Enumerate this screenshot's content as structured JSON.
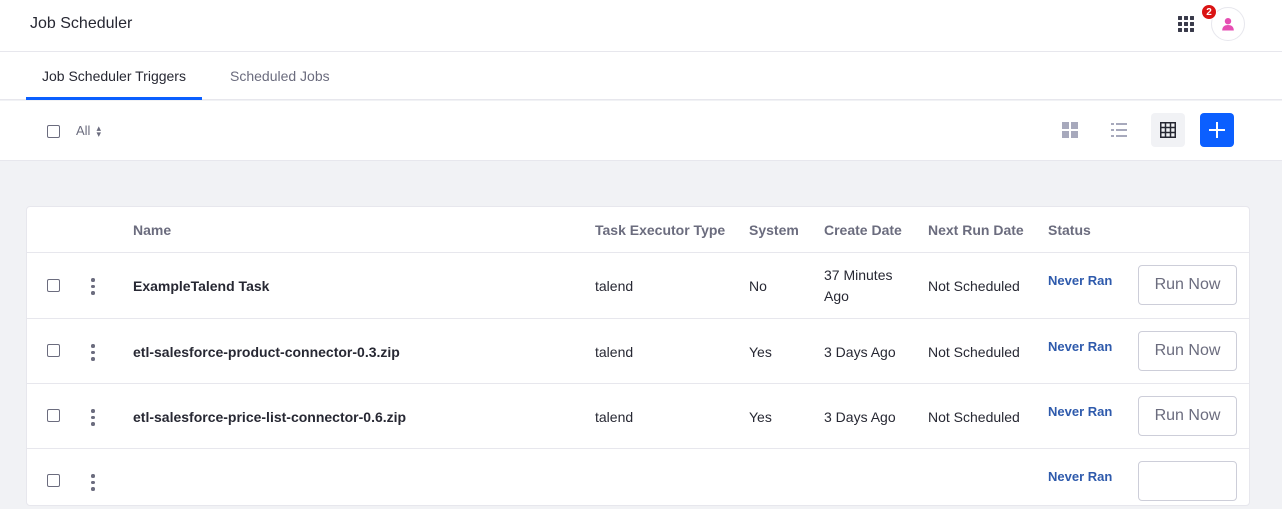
{
  "app": {
    "title": "Job Scheduler",
    "notification_count": "2"
  },
  "tabs": [
    {
      "label": "Job Scheduler Triggers",
      "active": true
    },
    {
      "label": "Scheduled Jobs",
      "active": false
    }
  ],
  "toolbar": {
    "filter_label": "All"
  },
  "table": {
    "headers": [
      "Name",
      "Task Executor Type",
      "System",
      "Create Date",
      "Next Run Date",
      "Status"
    ],
    "rows": [
      {
        "name": "ExampleTalend Task",
        "executor": "talend",
        "system": "No",
        "create_date_line1": "37 Minutes",
        "create_date_line2": "Ago",
        "next_run": "Not Scheduled",
        "status": "Never Ran",
        "action": "Run Now"
      },
      {
        "name": "etl-salesforce-product-connector-0.3.zip",
        "executor": "talend",
        "system": "Yes",
        "create_date_line1": "3 Days Ago",
        "create_date_line2": "",
        "next_run": "Not Scheduled",
        "status": "Never Ran",
        "action": "Run Now"
      },
      {
        "name": "etl-salesforce-price-list-connector-0.6.zip",
        "executor": "talend",
        "system": "Yes",
        "create_date_line1": "3 Days Ago",
        "create_date_line2": "",
        "next_run": "Not Scheduled",
        "status": "Never Ran",
        "action": "Run Now"
      },
      {
        "name": "",
        "executor": "",
        "system": "",
        "create_date_line1": "",
        "create_date_line2": "",
        "next_run": "",
        "status": "Never Ran",
        "action": ""
      }
    ]
  },
  "colors": {
    "accent": "#0b5fff",
    "status": "#2e5aac",
    "badge": "#da1414"
  }
}
